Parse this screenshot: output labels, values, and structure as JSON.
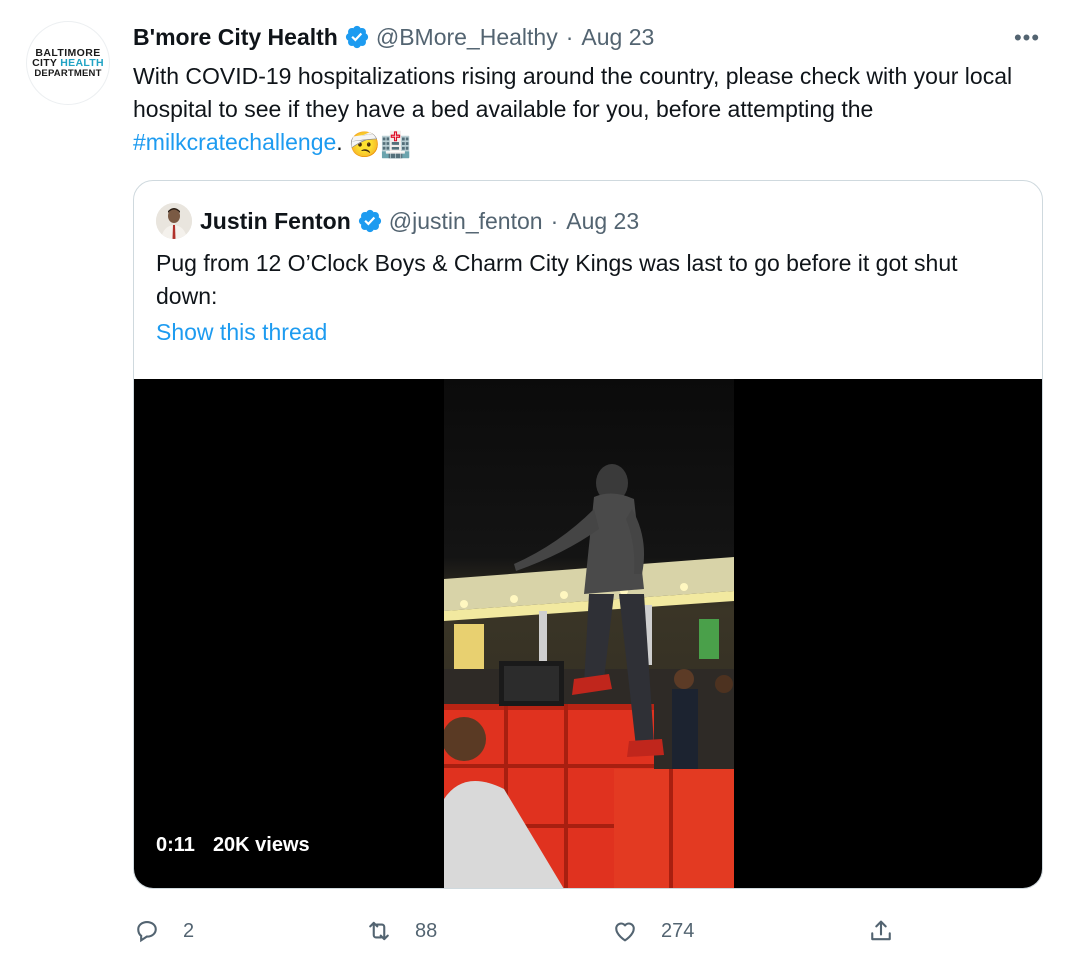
{
  "tweet": {
    "avatar_lines": [
      "BALTIMORE",
      "CITY",
      "HEALTH",
      "DEPARTMENT"
    ],
    "author_name": "B'more City Health",
    "handle": "@BMore_Healthy",
    "separator": "·",
    "date": "Aug 23",
    "more_label": "•••",
    "text_main": "With COVID-19 hospitalizations rising around the country, please check with your local hospital to see if they have a bed available for you, before attempting the ",
    "hashtag": "#milkcratechallenge",
    "text_after": ". ",
    "emojis": "🤕🏥",
    "verified_icon": "verified-badge-icon",
    "brand_color": "#1d9bf0"
  },
  "quote": {
    "author_name": "Justin Fenton",
    "handle": "@justin_fenton",
    "separator": "·",
    "date": "Aug 23",
    "text": "Pug from 12 O’Clock Boys & Charm City Kings was last to go before it got shut down:",
    "show_thread": "Show this thread",
    "video": {
      "duration": "0:11",
      "views": "20K views"
    }
  },
  "actions": {
    "reply": {
      "icon": "reply-icon",
      "count": "2"
    },
    "retweet": {
      "icon": "retweet-icon",
      "count": "88"
    },
    "like": {
      "icon": "heart-icon",
      "count": "274"
    },
    "share": {
      "icon": "share-icon"
    }
  }
}
